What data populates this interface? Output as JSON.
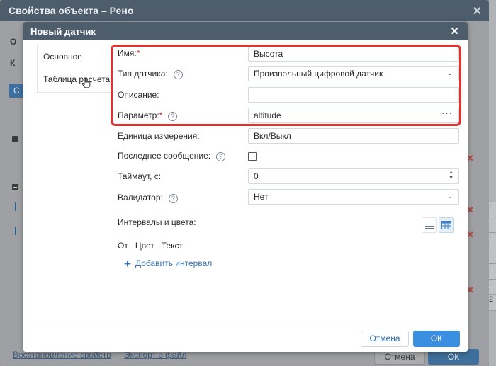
{
  "outer_dialog": {
    "title": "Свойства объекта – Рено",
    "fragment_a": "О",
    "fragment_b": "К",
    "fragment_c": "С",
    "footer_link_1": "Восстановление свойств",
    "footer_link_2": "Экспорт в файл",
    "cancel_label": "Отмена",
    "ok_label": "ОК",
    "right_table_header": "I",
    "right_table_rows": [
      "I",
      "I",
      "I",
      "I",
      "I",
      "2"
    ]
  },
  "modal": {
    "title": "Новый датчик",
    "nav": {
      "items": [
        {
          "label": "Основное"
        },
        {
          "label": "Таблица расчета"
        }
      ]
    },
    "form": {
      "name": {
        "label": "Имя:",
        "required_mark": "*",
        "value": "Высота"
      },
      "sensor_type": {
        "label": "Тип датчика:",
        "value": "Произвольный цифровой датчик"
      },
      "description": {
        "label": "Описание:",
        "value": ""
      },
      "parameter": {
        "label": "Параметр:",
        "required_mark": "*",
        "value": "altitude"
      },
      "unit": {
        "label": "Единица измерения:",
        "value": "Вкл/Выкл"
      },
      "last_message": {
        "label": "Последнее сообщение:",
        "checked": false
      },
      "timeout": {
        "label": "Таймаут, с:",
        "value": "0"
      },
      "validator": {
        "label": "Валидатор:",
        "value": "Нет"
      },
      "intervals": {
        "label": "Интервалы и цвета:"
      }
    },
    "intervals_table": {
      "columns": [
        "От",
        "Цвет",
        "Текст"
      ],
      "add_label": "Добавить интервал"
    },
    "buttons": {
      "cancel": "Отмена",
      "ok": "ОК"
    }
  },
  "colors": {
    "header": "#4e5d6c",
    "accent": "#3a8fe0",
    "highlight": "#e0322e",
    "required": "#d9232d",
    "link": "#3572b5"
  },
  "icons": {
    "help": "question-circle-icon",
    "dropdown": "chevron-down-icon",
    "more": "ellipsis-icon",
    "spinner": "up-down-icon",
    "add": "plus-icon"
  }
}
